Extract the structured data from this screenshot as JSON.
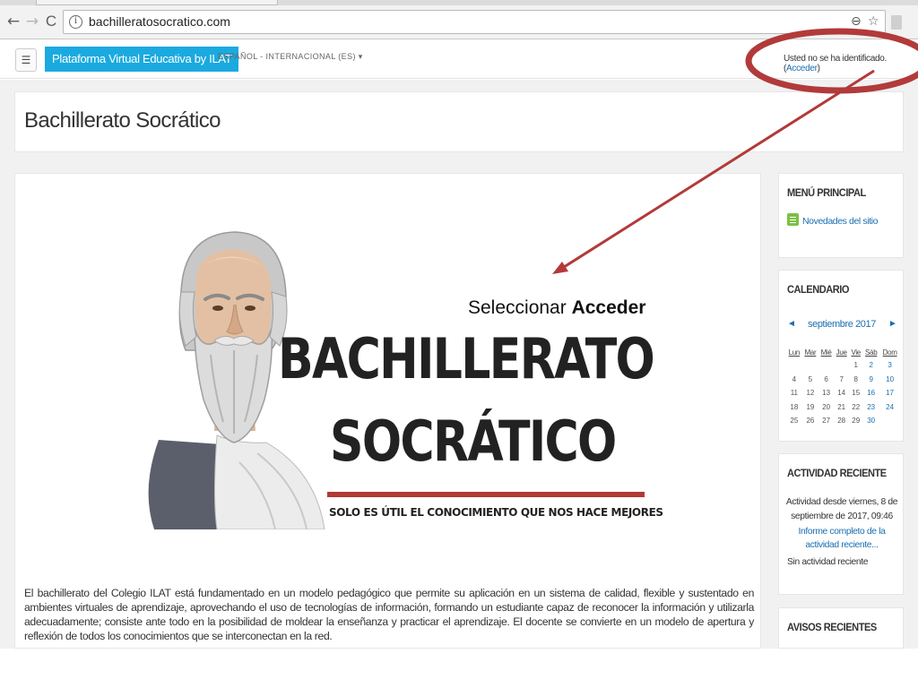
{
  "browser": {
    "url": "bachilleratosocratico.com",
    "back_icon": "←",
    "forward_icon": "→",
    "reload_icon": "C",
    "zoom_icon": "⊖",
    "star_icon": "☆"
  },
  "navbar": {
    "menu_icon": "☰",
    "brand": "Plataforma Virtual Educativa by ILAT",
    "language": "ESPAÑOL - INTERNACIONAL (ES) ▾",
    "login_text": "Usted no se ha identificado. (",
    "login_link": "Acceder",
    "login_close": ")"
  },
  "page": {
    "title": "Bachillerato Socrático"
  },
  "main": {
    "logo_line1": "BACHILLERATO",
    "logo_line2": "SOCRÁTICO",
    "tagline": "SOLO ES ÚTIL EL CONOCIMIENTO QUE NOS HACE MEJORES",
    "annotation_prefix": "Seleccionar ",
    "annotation_bold": "Acceder",
    "description": "El bachillerato del Colegio ILAT está fundamentado  en un modelo pedagógico que permite su aplicación en un sistema de calidad, flexible y sustentado en ambientes virtuales de aprendizaje, aprovechando el uso de tecnologías de información, formando un estudiante capaz de reconocer la información y utilizarla adecuadamente; consiste ante todo en la posibilidad de moldear la enseñanza y practicar el aprendizaje. El docente se convierte en un modelo de apertura y reflexión de todos los conocimientos que se interconectan en la red."
  },
  "sidebar": {
    "menu": {
      "title": "MENÚ PRINCIPAL",
      "link": "Novedades del sitio"
    },
    "calendar": {
      "title": "CALENDARIO",
      "prev": "◄",
      "next": "►",
      "month": "septiembre 2017",
      "weekdays": [
        "Lun",
        "Mar",
        "Mié",
        "Jue",
        "Vie",
        "Sáb",
        "Dom"
      ],
      "weeks": [
        [
          "",
          "",
          "",
          "",
          "1",
          "2",
          "3"
        ],
        [
          "4",
          "5",
          "6",
          "7",
          "8",
          "9",
          "10"
        ],
        [
          "11",
          "12",
          "13",
          "14",
          "15",
          "16",
          "17"
        ],
        [
          "18",
          "19",
          "20",
          "21",
          "22",
          "23",
          "24"
        ],
        [
          "25",
          "26",
          "27",
          "28",
          "29",
          "30",
          ""
        ]
      ]
    },
    "activity": {
      "title": "ACTIVIDAD RECIENTE",
      "since": "Actividad desde viernes, 8 de septiembre de 2017, 09:46",
      "report_link": "Informe completo de la actividad reciente...",
      "none": "Sin actividad reciente"
    },
    "news": {
      "title": "AVISOS RECIENTES"
    }
  },
  "colors": {
    "brand": "#1aaadf",
    "link": "#1a6fb0",
    "annotation": "#b23a3a",
    "logo_bar": "#b03a35"
  }
}
